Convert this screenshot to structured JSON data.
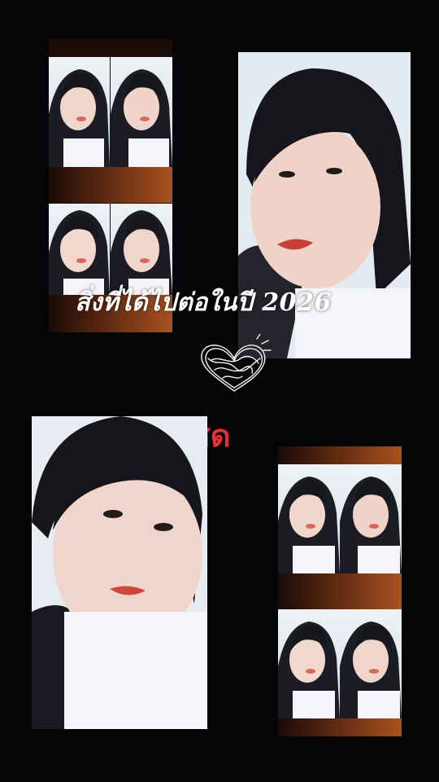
{
  "caption": {
    "title": "สิ่งที่ได้ไปต่อในปี 2026",
    "status": ":โสด"
  },
  "decor": {
    "heart_icon": "scribble-heart-icon",
    "accent_red": "#e8303b",
    "text_white": "#ffffff",
    "background": "#050406",
    "strip_glow": "#a85220"
  }
}
